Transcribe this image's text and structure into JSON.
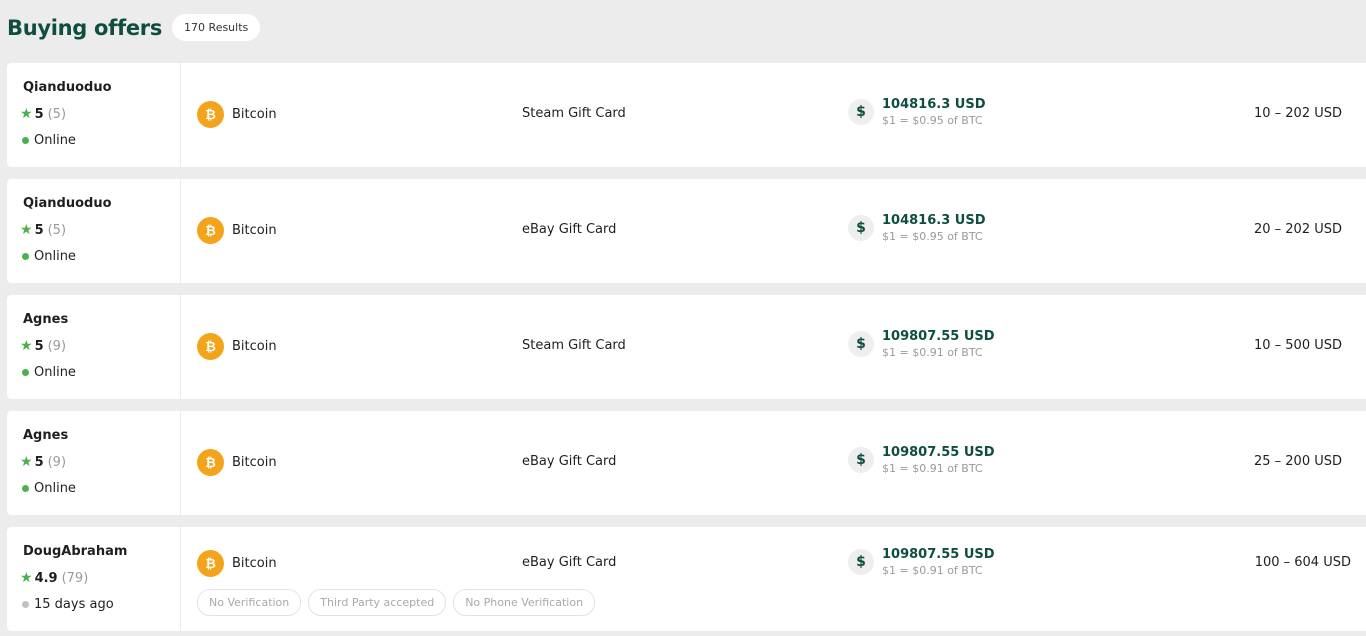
{
  "header": {
    "title": "Buying offers",
    "results": "170 Results"
  },
  "offers": [
    {
      "username": "Qianduoduo",
      "rating": "5",
      "reviews": "(5)",
      "status": "Online",
      "crypto": "Bitcoin",
      "payment": "Steam Gift Card",
      "price": "104816.3 USD",
      "rate": "$1 = $0.95 of BTC",
      "limits": "10 – 202 USD"
    },
    {
      "username": "Qianduoduo",
      "rating": "5",
      "reviews": "(5)",
      "status": "Online",
      "crypto": "Bitcoin",
      "payment": "eBay Gift Card",
      "price": "104816.3 USD",
      "rate": "$1 = $0.95 of BTC",
      "limits": "20 – 202 USD"
    },
    {
      "username": "Agnes",
      "rating": "5",
      "reviews": "(9)",
      "status": "Online",
      "crypto": "Bitcoin",
      "payment": "Steam Gift Card",
      "price": "109807.55 USD",
      "rate": "$1 = $0.91 of BTC",
      "limits": "10 – 500 USD"
    },
    {
      "username": "Agnes",
      "rating": "5",
      "reviews": "(9)",
      "status": "Online",
      "crypto": "Bitcoin",
      "payment": "eBay Gift Card",
      "price": "109807.55 USD",
      "rate": "$1 = $0.91 of BTC",
      "limits": "25 – 200 USD"
    },
    {
      "username": "DougAbraham",
      "rating": "4.9",
      "reviews": "(79)",
      "status": "15 days ago",
      "crypto": "Bitcoin",
      "payment": "eBay Gift Card",
      "price": "109807.55 USD",
      "rate": "$1 = $0.91 of BTC",
      "limits": "100 – 604 USD",
      "tags": [
        "No Verification",
        "Third Party accepted",
        "No Phone Verification"
      ]
    }
  ],
  "icons": {
    "star": "star-icon",
    "bitcoin": "bitcoin-icon",
    "dollar": "dollar-icon"
  },
  "colors": {
    "brand": "#0f4d40",
    "online": "#4caf50",
    "bitcoin": "#f4a41b",
    "background": "#ececec"
  }
}
